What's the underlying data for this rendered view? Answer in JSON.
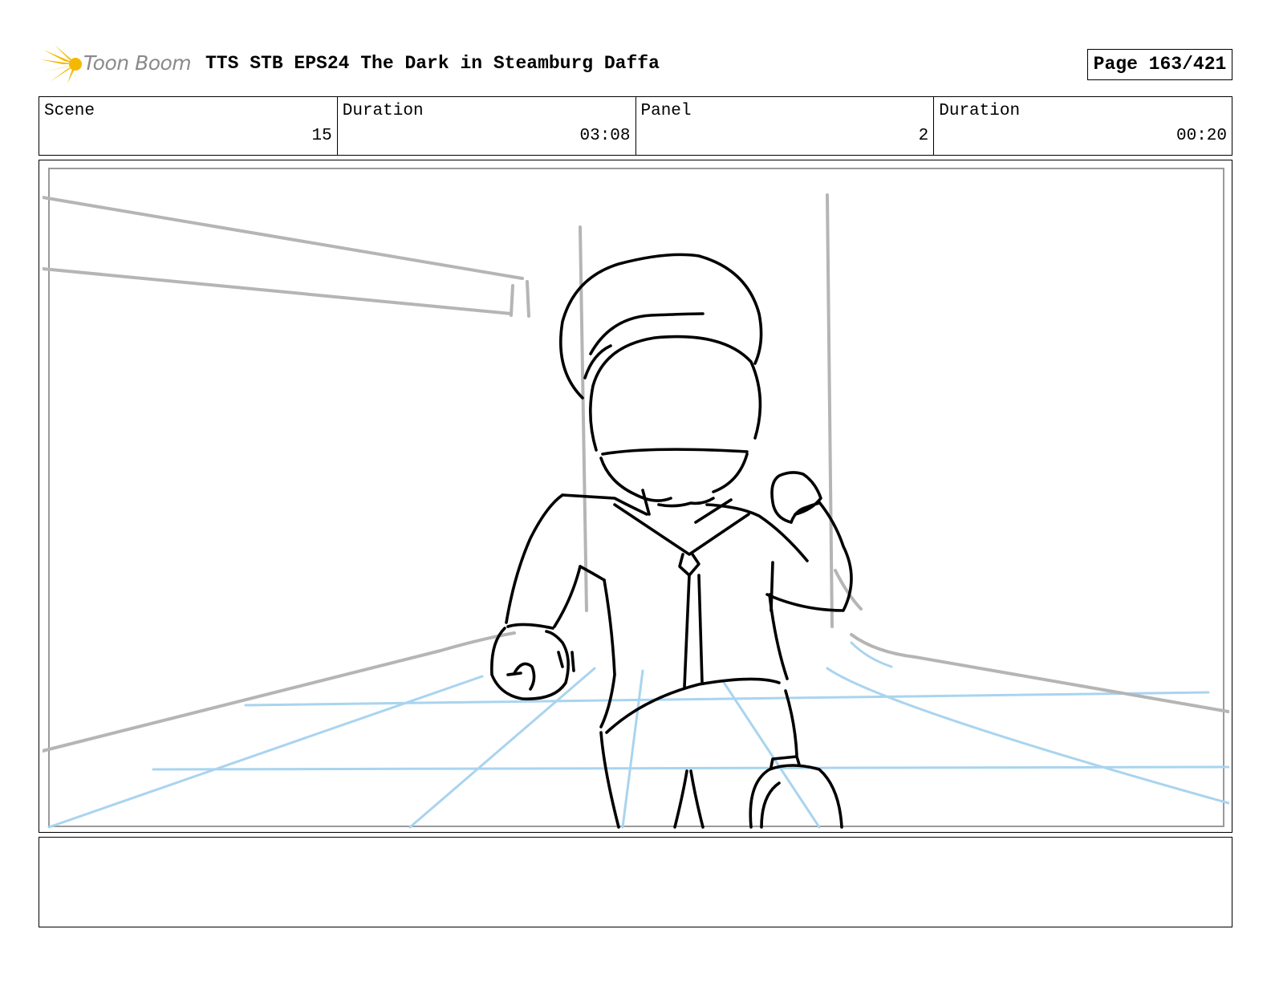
{
  "header": {
    "logo_text": "Toon Boom",
    "title": "TTS STB EPS24 The Dark in Steamburg Daffa",
    "page": "Page 163/421"
  },
  "info": {
    "scene_label": "Scene",
    "scene_value": "15",
    "scene_duration_label": "Duration",
    "scene_duration_value": "03:08",
    "panel_label": "Panel",
    "panel_value": "2",
    "panel_duration_label": "Duration",
    "panel_duration_value": "00:20"
  },
  "notes": {
    "text": ""
  },
  "colors": {
    "logo_accent": "#f5b800",
    "perspective_grid": "#a9d4ef",
    "background_lines": "#b5b5b5",
    "character_ink": "#000000"
  }
}
